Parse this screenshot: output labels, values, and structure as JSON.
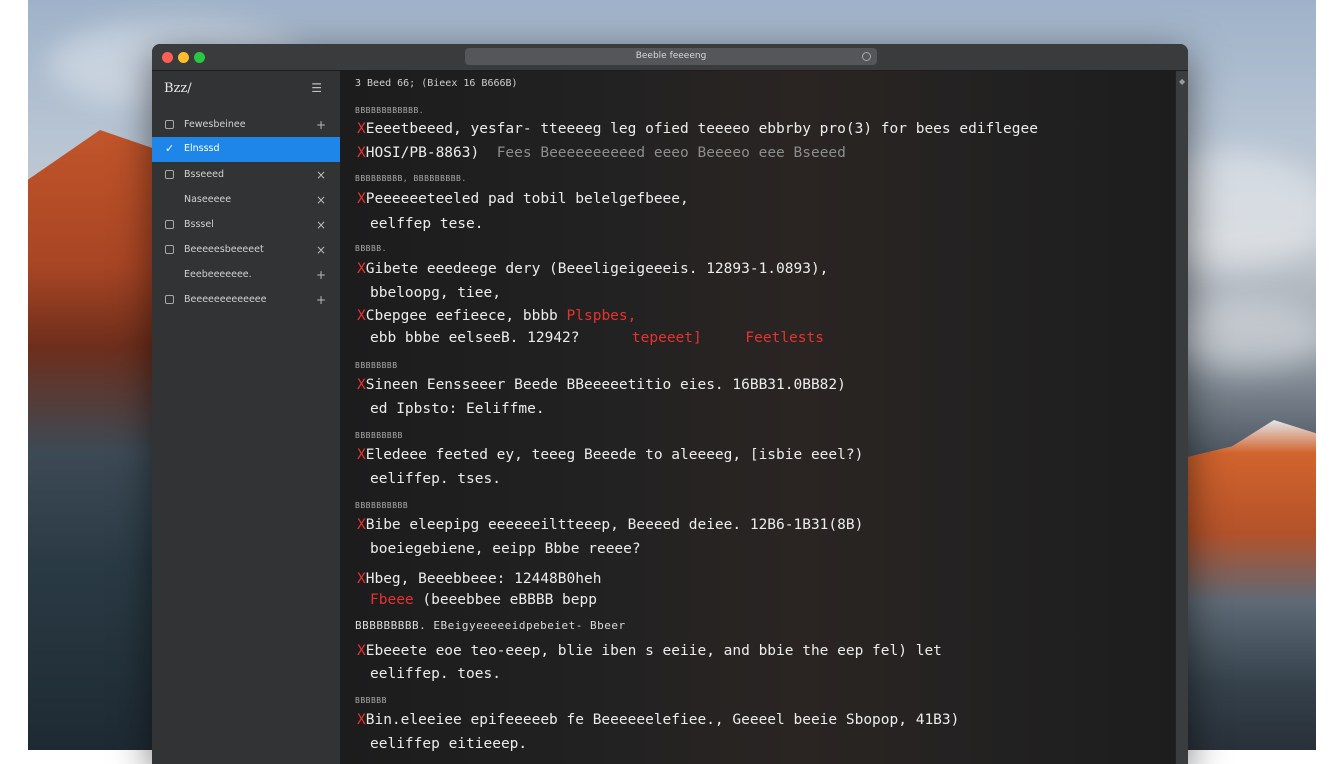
{
  "window": {
    "url": "Beeble feeeeng"
  },
  "sidebar": {
    "logo": "Bzz/",
    "menu_icon": "list-icon",
    "items": [
      {
        "label": "Fewesbeinee",
        "action": "+",
        "icon": "folder-icon"
      },
      {
        "label": "Elnsssd",
        "action": "",
        "icon": "checkmark-icon",
        "active": true
      },
      {
        "label": "Bsseeed",
        "action": "×",
        "icon": "doc-icon"
      },
      {
        "label": "Naseeeee",
        "action": "×",
        "icon": "none"
      },
      {
        "label": "Bsssel",
        "action": "×",
        "icon": "grid-icon"
      },
      {
        "label": "Beeeeesbeeeeet",
        "action": "×",
        "icon": "doc-icon"
      },
      {
        "label": "Eeebeeeeeee.",
        "action": "+",
        "icon": "none"
      },
      {
        "label": "Beeeeeeeeeeeee",
        "action": "+",
        "icon": "doc-icon"
      }
    ]
  },
  "terminal": {
    "header": "3 Beed 66; (Bieex 16 B666B)",
    "blocks": [
      {
        "section": "BBBBBBBBBBBB.",
        "lines": [
          {
            "x": true,
            "text": "Eeeetbeeed, yesfar- tteeeeg leg ofied teeeeo ebbrby pro(3) for bees ediflegee"
          },
          {
            "x": true,
            "text": "HOSI/PB-8863)",
            "dim": "Fees Beeeeeeeeeed eeeo Beeeeo eee Bseeed"
          }
        ]
      },
      {
        "section": "BBBBBBBBB, BBBBBBBBB.",
        "lines": [
          {
            "x": true,
            "text": "Peeeeeeteeled pad tobil belelgefbeee,"
          },
          {
            "x": false,
            "text": "eelffep tese."
          }
        ]
      },
      {
        "section": "BBBBB.",
        "lines": [
          {
            "x": true,
            "text": "Gibete eeedeege dery (Beeeligeigeeeis. 12893-1.0893),"
          },
          {
            "x": false,
            "text": "bbeloopg, tiee,"
          },
          {
            "x": true,
            "text": "Cbepgee eefieece, bbbb ",
            "red": "Plspbes,"
          },
          {
            "x": false,
            "text": "ebb bbbe eelseeB. 12942?",
            "red_a": "tepeeet]",
            "red_b": "Feetlests"
          }
        ]
      },
      {
        "section": "BBBBBBBB",
        "lines": [
          {
            "x": true,
            "text": "Sineen Eensseeer Beede BBeeeeetitio eies. 16BB31.0BB82)"
          },
          {
            "x": false,
            "text": "ed Ipbsto: Eeliffme."
          }
        ]
      },
      {
        "section": "BBBBBBBBB",
        "lines": [
          {
            "x": true,
            "text": "Eledeee feeted ey, teeeg Beeede to aleeeeg, [isbie eeel?)"
          },
          {
            "x": false,
            "text": "eeliffep. tses."
          }
        ]
      },
      {
        "section": "BBBBBBBBBB",
        "lines": [
          {
            "x": true,
            "text": "Bibe eleepipg eeeeeeiltteeep, Beeeed deiee. 12B6-1B31(8B)"
          },
          {
            "x": false,
            "text": "boeiegebiene, eeipp Bbbe reeee?"
          }
        ]
      },
      {
        "section": "",
        "lines": [
          {
            "x": true,
            "text": "Hbeg, Beeebbeee: 12448B0heh"
          },
          {
            "x": false,
            "red": "Fbeee",
            "text": " (beeebbee eBBBB bepp"
          }
        ]
      },
      {
        "section": "BBBBBBBBB. EBeigyeeeeeidpebeiet- Bbeer",
        "lines": [
          {
            "x": true,
            "text": "Ebeeete eoe teo-eeep, blie iben s eeiie, and bbie the eep fel) let"
          },
          {
            "x": false,
            "text": "eeliffep. toes."
          }
        ]
      },
      {
        "section": "BBBBBB",
        "lines": [
          {
            "x": true,
            "text": "Bin.eleeiee epifeeeeeb fe Beeeeeelefiee., Geeeel beeie Sbopop, 41B3)"
          },
          {
            "x": false,
            "text": "eeliffep eitieeep."
          }
        ]
      }
    ]
  }
}
